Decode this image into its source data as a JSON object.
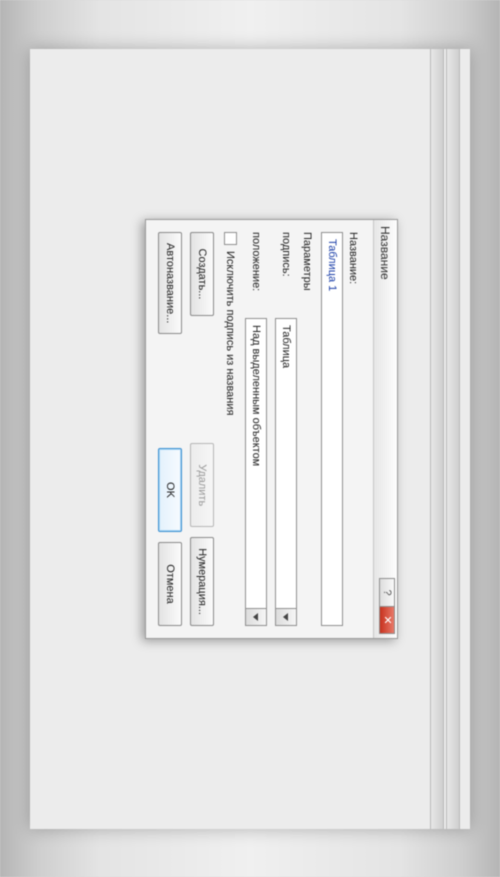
{
  "dialog": {
    "title": "Название",
    "help_symbol": "?",
    "close_symbol": "✕",
    "name_label": "Название:",
    "name_value": "Таблица 1",
    "params_label": "Параметры",
    "caption_type_label": "подпись:",
    "caption_type_value": "Таблица",
    "position_label": "положение:",
    "position_value": "Над выделенным объектом",
    "exclude_label": "Исключить подпись из названия",
    "create_button": "Создать...",
    "delete_button": "Удалить",
    "numbering_button": "Нумерация...",
    "autoname_button": "Автоназвание...",
    "ok_button": "OK",
    "cancel_button": "Отмена"
  }
}
